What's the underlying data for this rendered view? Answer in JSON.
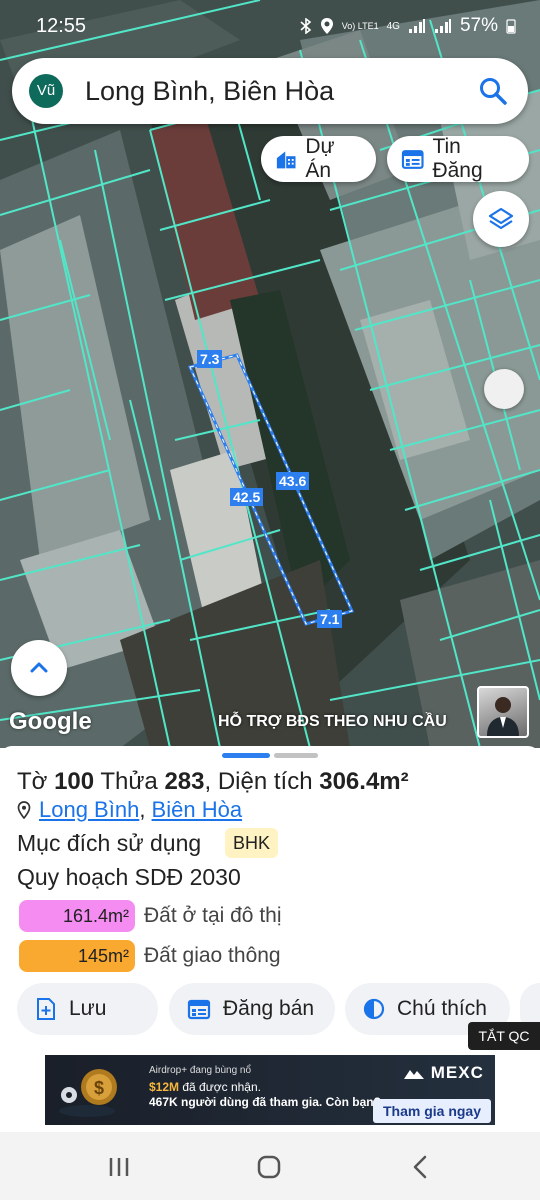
{
  "status_bar": {
    "time": "12:55",
    "network_label": "Vo) LTE1",
    "signal_label": "4G",
    "battery": "57%"
  },
  "search": {
    "avatar": "Vũ",
    "text": "Long Bình, Biên Hòa"
  },
  "chips": {
    "du_an": "Dự Án",
    "tin_dang": "Tin Đăng"
  },
  "map": {
    "measurements": {
      "top": "7.3",
      "right_side": "43.6",
      "left_side": "42.5",
      "bottom": "7.1"
    },
    "google_label": "Google",
    "support_text": "HỖ TRỢ BĐS  THEO NHU CẦU"
  },
  "parcel": {
    "to_label": "Tờ",
    "to_value": "100",
    "thua_label": "Thửa",
    "thua_value": "283",
    "area_label": "Diện tích",
    "area_value": "306.4m²",
    "ward": "Long Bình",
    "city": "Biên Hòa",
    "purpose_label": "Mục đích sử dụng",
    "purpose_code": "BHK",
    "plan_title": "Quy hoạch SDĐ 2030",
    "plan_items": [
      {
        "value": "161.4m²",
        "label": "Đất ở tại đô thị",
        "color": "#f48cf2"
      },
      {
        "value": "145m²",
        "label": "Đất giao thông",
        "color": "#f9a930"
      }
    ]
  },
  "actions": {
    "save": "Lưu",
    "post": "Đăng bán",
    "legend": "Chú thích"
  },
  "ad": {
    "hide_label": "TẮT QC",
    "line1": "Airdrop+ đang bùng nổ",
    "line2_amount": "$12M",
    "line2_rest": " đã được nhận.",
    "line3": "467K người dùng đã tham gia. Còn bạn?",
    "brand": "MEXC",
    "cta": "Tham gia ngay"
  },
  "colors": {
    "accent": "#1a73e8",
    "parcel_lines": "#52e6c8",
    "measure_bg": "#2d7ff0",
    "badge_bg": "#fff3c4"
  }
}
